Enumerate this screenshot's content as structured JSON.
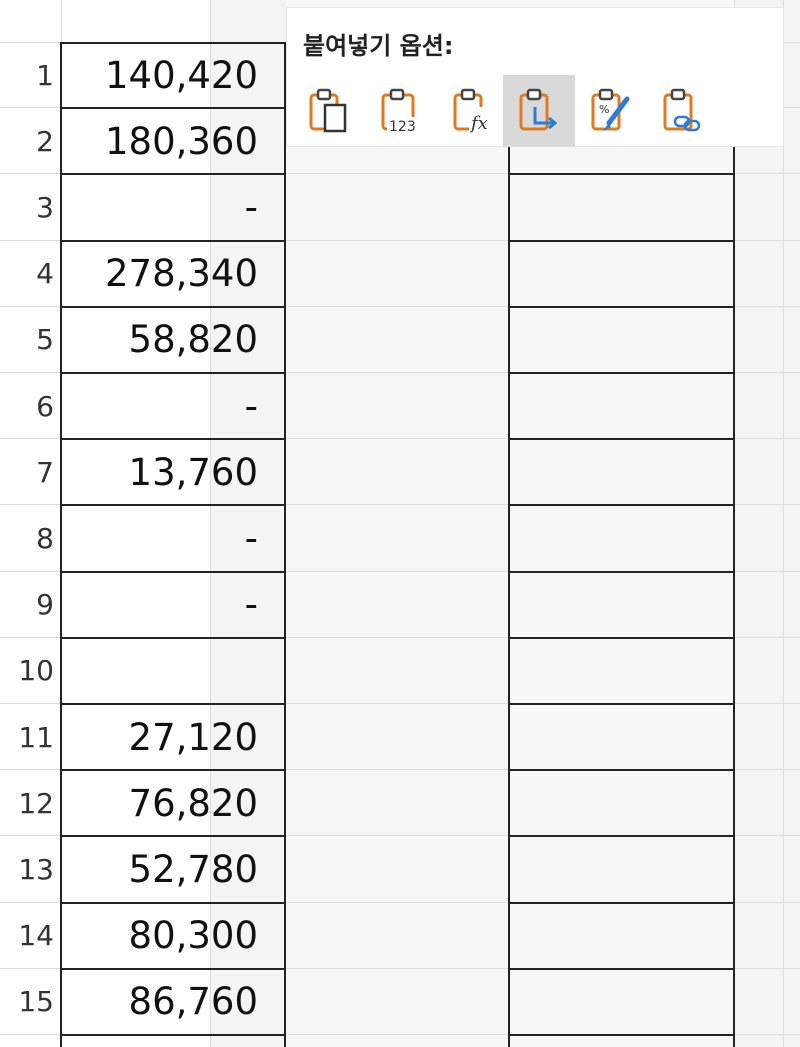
{
  "sheet": {
    "rows": [
      {
        "num": "1",
        "value": "140,420"
      },
      {
        "num": "2",
        "value": "180,360"
      },
      {
        "num": "3",
        "value": "-"
      },
      {
        "num": "4",
        "value": "278,340"
      },
      {
        "num": "5",
        "value": "58,820"
      },
      {
        "num": "6",
        "value": "-"
      },
      {
        "num": "7",
        "value": "13,760"
      },
      {
        "num": "8",
        "value": "-"
      },
      {
        "num": "9",
        "value": "-"
      },
      {
        "num": "10",
        "value": ""
      },
      {
        "num": "11",
        "value": "27,120"
      },
      {
        "num": "12",
        "value": "76,820"
      },
      {
        "num": "13",
        "value": "52,780"
      },
      {
        "num": "14",
        "value": "80,300"
      },
      {
        "num": "15",
        "value": "86,760"
      }
    ]
  },
  "paste_options": {
    "title": "붙여넣기 옵션:",
    "buttons": [
      {
        "name": "paste-icon",
        "selected": false
      },
      {
        "name": "paste-values-icon",
        "selected": false
      },
      {
        "name": "paste-formulas-icon",
        "selected": false
      },
      {
        "name": "paste-transpose-icon",
        "selected": true
      },
      {
        "name": "paste-formatting-icon",
        "selected": false
      },
      {
        "name": "paste-link-icon",
        "selected": false
      }
    ],
    "icon_text": {
      "values": "123",
      "formulas": "fx"
    },
    "colors": {
      "clipboard": "#e07a1f",
      "accent": "#2b7cd3",
      "selected_bg": "#d9d9d9"
    }
  }
}
